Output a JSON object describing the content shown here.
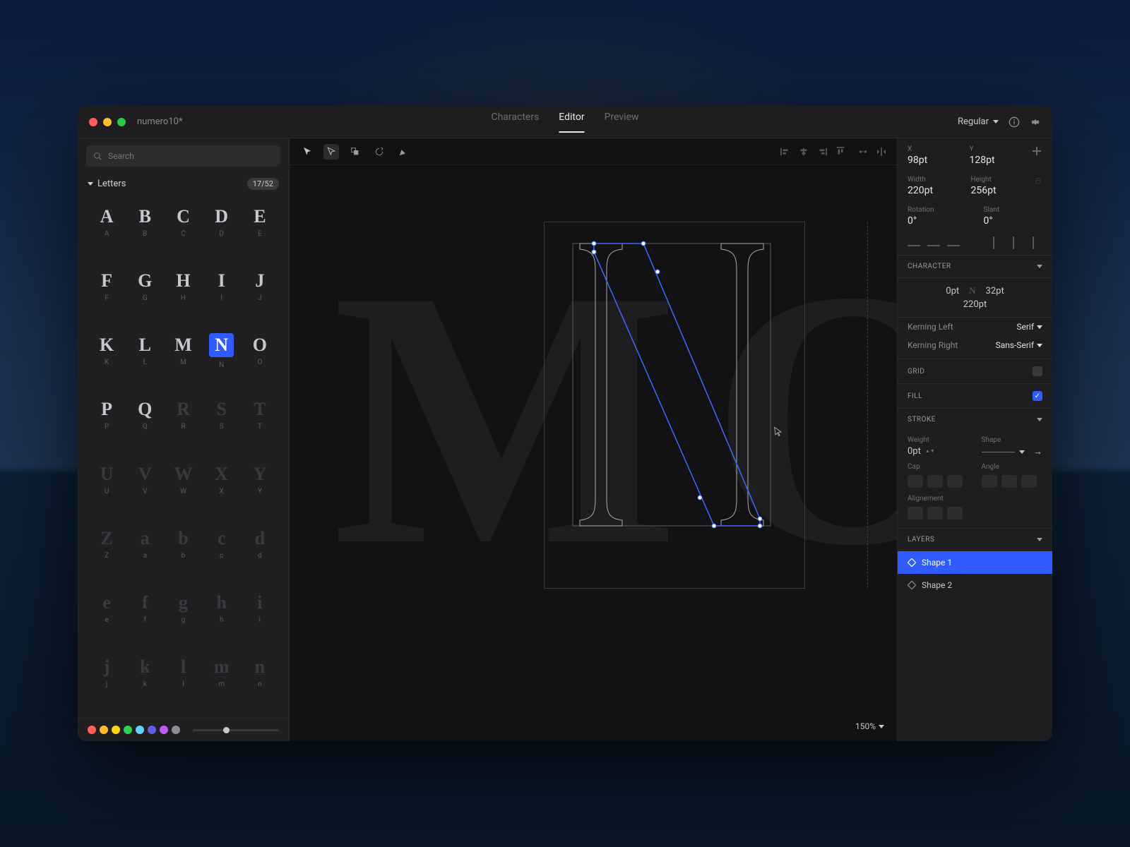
{
  "window": {
    "title": "numero10*"
  },
  "tabs": {
    "characters": "Characters",
    "editor": "Editor",
    "preview": "Preview",
    "active": "Editor"
  },
  "titlebar_right": {
    "style": "Regular"
  },
  "search": {
    "placeholder": "Search"
  },
  "category": {
    "name": "Letters",
    "count": "17/52"
  },
  "glyphs": [
    {
      "g": "A",
      "l": "A",
      "dim": false
    },
    {
      "g": "B",
      "l": "B",
      "dim": false
    },
    {
      "g": "C",
      "l": "C",
      "dim": false
    },
    {
      "g": "D",
      "l": "D",
      "dim": false
    },
    {
      "g": "E",
      "l": "E",
      "dim": false
    },
    {
      "g": "F",
      "l": "F",
      "dim": false
    },
    {
      "g": "G",
      "l": "G",
      "dim": false
    },
    {
      "g": "H",
      "l": "H",
      "dim": false
    },
    {
      "g": "I",
      "l": "I",
      "dim": false
    },
    {
      "g": "J",
      "l": "J",
      "dim": false
    },
    {
      "g": "K",
      "l": "K",
      "dim": false
    },
    {
      "g": "L",
      "l": "L",
      "dim": false
    },
    {
      "g": "M",
      "l": "M",
      "dim": false
    },
    {
      "g": "N",
      "l": "N",
      "dim": false,
      "sel": true
    },
    {
      "g": "O",
      "l": "O",
      "dim": false
    },
    {
      "g": "P",
      "l": "P",
      "dim": false
    },
    {
      "g": "Q",
      "l": "Q",
      "dim": false
    },
    {
      "g": "R",
      "l": "R",
      "dim": true
    },
    {
      "g": "S",
      "l": "S",
      "dim": true
    },
    {
      "g": "T",
      "l": "T",
      "dim": true
    },
    {
      "g": "U",
      "l": "U",
      "dim": true
    },
    {
      "g": "V",
      "l": "V",
      "dim": true
    },
    {
      "g": "W",
      "l": "W",
      "dim": true
    },
    {
      "g": "X",
      "l": "X",
      "dim": true
    },
    {
      "g": "Y",
      "l": "Y",
      "dim": true
    },
    {
      "g": "Z",
      "l": "Z",
      "dim": true
    },
    {
      "g": "a",
      "l": "a",
      "dim": true
    },
    {
      "g": "b",
      "l": "b",
      "dim": true
    },
    {
      "g": "c",
      "l": "c",
      "dim": true
    },
    {
      "g": "d",
      "l": "d",
      "dim": true
    },
    {
      "g": "e",
      "l": "e",
      "dim": true
    },
    {
      "g": "f",
      "l": "f",
      "dim": true
    },
    {
      "g": "g",
      "l": "g",
      "dim": true
    },
    {
      "g": "h",
      "l": "h",
      "dim": true
    },
    {
      "g": "i",
      "l": "i",
      "dim": true
    },
    {
      "g": "j",
      "l": "j",
      "dim": true
    },
    {
      "g": "k",
      "l": "k",
      "dim": true
    },
    {
      "g": "l",
      "l": "l",
      "dim": true
    },
    {
      "g": "m",
      "l": "m",
      "dim": true
    },
    {
      "g": "n",
      "l": "n",
      "dim": true
    }
  ],
  "swatches": [
    "#ff5f57",
    "#febc2e",
    "#ffd60a",
    "#30d158",
    "#64d2ff",
    "#5e5ce6",
    "#bf5af2",
    "#8e8e93"
  ],
  "canvas": {
    "left_ghost": "M",
    "right_ghost": "O",
    "zoom": "150%"
  },
  "inspector": {
    "x_label": "X",
    "x": "98pt",
    "y_label": "Y",
    "y": "128pt",
    "width_label": "Width",
    "width": "220pt",
    "height_label": "Height",
    "height": "256pt",
    "rotation_label": "Rotation",
    "rotation": "0°",
    "slant_label": "Slant",
    "slant": "0°",
    "character_head": "CHARACTER",
    "char_left": "0pt",
    "char_glyph": "N",
    "char_right": "32pt",
    "char_width": "220pt",
    "kern_left_label": "Kerning Left",
    "kern_left": "Serif",
    "kern_right_label": "Kerning Right",
    "kern_right": "Sans-Serif",
    "grid_head": "GRID",
    "fill_head": "FILL",
    "stroke_head": "STROKE",
    "weight_label": "Weight",
    "weight": "0pt",
    "shape_label": "Shape",
    "cap_label": "Cap",
    "angle_label": "Angle",
    "alignment_label": "Alignement",
    "layers_head": "LAYERS",
    "layer1": "Shape 1",
    "layer2": "Shape 2"
  }
}
